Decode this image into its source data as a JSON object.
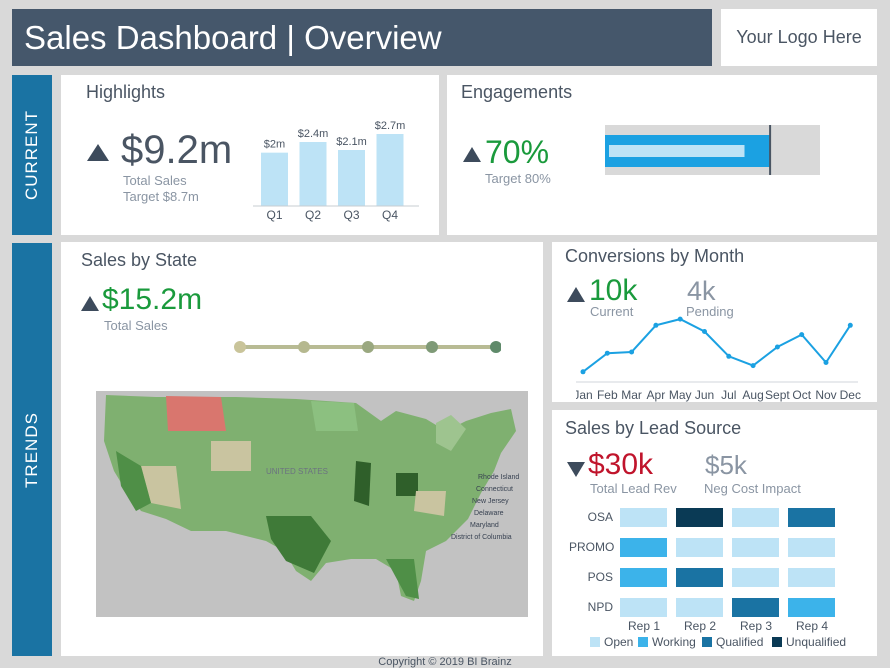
{
  "header": {
    "title": "Sales Dashboard | Overview",
    "logo": "Your Logo Here"
  },
  "tabs": {
    "current": "CURRENT",
    "trends": "TRENDS"
  },
  "highlights": {
    "title": "Highlights",
    "value": "$9.2m",
    "label": "Total Sales",
    "target": "Target $8.7m",
    "chart_data": {
      "type": "bar",
      "categories": [
        "Q1",
        "Q2",
        "Q3",
        "Q4"
      ],
      "values": [
        2.0,
        2.4,
        2.1,
        2.7
      ],
      "data_labels": [
        "$2m",
        "$2.4m",
        "$2.1m",
        "$2.7m"
      ],
      "color": "#bde3f6"
    }
  },
  "engagements": {
    "title": "Engagements",
    "value": "70%",
    "target": "Target 80%",
    "bullet": {
      "actual": 70,
      "target": 80,
      "max": 100
    }
  },
  "sales_by_state": {
    "title": "Sales by State",
    "value": "$15.2m",
    "label": "Total Sales",
    "legend_dots": [
      "#c9c49a",
      "#b5b88f",
      "#9aa880",
      "#7f9a77",
      "#5f8a6a"
    ],
    "map_labels": [
      "Rhode Island",
      "Connecticut",
      "New Jersey",
      "Delaware",
      "Maryland",
      "District of Columbia",
      "UNITED STATES"
    ]
  },
  "conversions": {
    "title": "Conversions by Month",
    "current_value": "10k",
    "current_label": "Current",
    "pending_value": "4k",
    "pending_label": "Pending",
    "chart_data": {
      "type": "line",
      "categories": [
        "Jan",
        "Feb",
        "Mar",
        "Apr",
        "May",
        "Jun",
        "Jul",
        "Aug",
        "Sept",
        "Oct",
        "Nov",
        "Dec"
      ],
      "values": [
        1,
        4,
        4.2,
        8.5,
        9.5,
        7.5,
        3.5,
        2,
        5,
        7,
        2.5,
        8.5
      ],
      "color": "#1ba1e2"
    }
  },
  "lead_source": {
    "title": "Sales by Lead Source",
    "value": "$30k",
    "label": "Total Lead Rev",
    "cost_value": "$5k",
    "cost_label": "Neg Cost Impact",
    "chart_data": {
      "type": "heatmap",
      "rows": [
        "OSA",
        "PROMO",
        "POS",
        "NPD"
      ],
      "cols": [
        "Rep 1",
        "Rep 2",
        "Rep 3",
        "Rep 4"
      ],
      "values": [
        [
          0,
          3,
          0,
          2
        ],
        [
          1,
          0,
          0,
          0
        ],
        [
          1,
          2,
          0,
          0
        ],
        [
          0,
          0,
          2,
          1
        ]
      ],
      "categories": [
        "Open",
        "Working",
        "Qualified",
        "Unqualified"
      ],
      "colors": [
        "#bde3f6",
        "#3cb3ea",
        "#1a73a3",
        "#0a3a55"
      ]
    }
  },
  "footer": {
    "copyright": "Copyright © 2019 BI Brainz"
  }
}
